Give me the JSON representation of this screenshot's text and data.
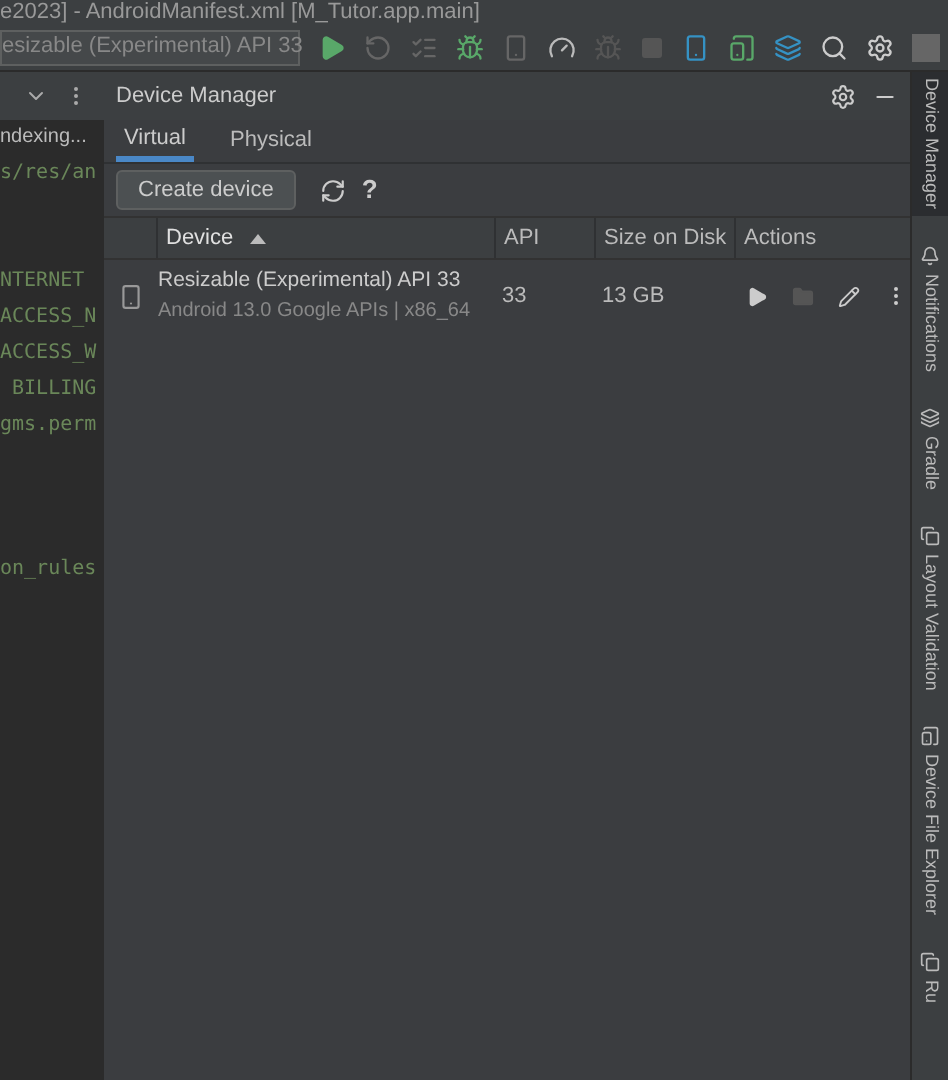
{
  "title_bar": {
    "title": "e2023] - AndroidManifest.xml [M_Tutor.app.main]"
  },
  "toolbar": {
    "device_selector": "esizable (Experimental) API 33"
  },
  "editor": {
    "status": "ndexing...",
    "lines": [
      {
        "kind": "code",
        "text": "s/res/an"
      },
      {
        "kind": "blank"
      },
      {
        "kind": "blank"
      },
      {
        "kind": "code",
        "text": "NTERNET"
      },
      {
        "kind": "code",
        "text": "ACCESS_N"
      },
      {
        "kind": "code",
        "text": "ACCESS_W"
      },
      {
        "kind": "code",
        "text": " BILLING"
      },
      {
        "kind": "code",
        "text": "gms.perm"
      },
      {
        "kind": "blank"
      },
      {
        "kind": "blank"
      },
      {
        "kind": "blank"
      },
      {
        "kind": "code",
        "text": "on_rules"
      }
    ]
  },
  "device_manager": {
    "title": "Device Manager",
    "tabs": [
      {
        "label": "Virtual",
        "selected": true
      },
      {
        "label": "Physical",
        "selected": false
      }
    ],
    "create_button": "Create device",
    "help": "?",
    "columns": [
      {
        "label": "Device",
        "sorted": true
      },
      {
        "label": "API",
        "sorted": false
      },
      {
        "label": "Size on Disk",
        "sorted": false
      },
      {
        "label": "Actions",
        "sorted": false
      }
    ],
    "rows": [
      {
        "name": "Resizable (Experimental) API 33",
        "details": "Android 13.0 Google APIs | x86_64",
        "api": "33",
        "size": "13 GB"
      }
    ]
  },
  "side_tabs": [
    {
      "label": "Device Manager",
      "selected": true
    },
    {
      "label": "Notifications",
      "selected": false
    },
    {
      "label": "Gradle",
      "selected": false
    },
    {
      "label": "Layout Validation",
      "selected": false
    },
    {
      "label": "Device File Explorer",
      "selected": false
    },
    {
      "label": "Ru",
      "selected": false
    }
  ]
}
